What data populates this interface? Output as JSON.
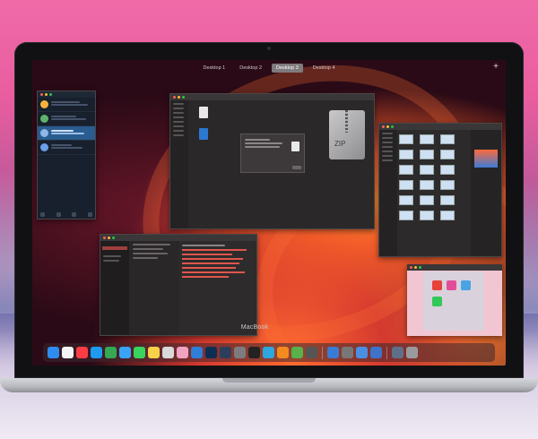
{
  "spaces": {
    "tabs": [
      {
        "label": "Desktop 1",
        "active": false
      },
      {
        "label": "Desktop 2",
        "active": false
      },
      {
        "label": "Desktop 3",
        "active": true
      },
      {
        "label": "Desktop 4",
        "active": false
      }
    ],
    "add_label": "+"
  },
  "finder": {
    "zip_label": "ZIP"
  },
  "laptop": {
    "brand": "MacBook"
  },
  "dock": {
    "icons": [
      {
        "name": "finder-icon",
        "color": "#2e8cf0"
      },
      {
        "name": "calendar-icon",
        "color": "#f4f4f4"
      },
      {
        "name": "music-icon",
        "color": "#fc3c44"
      },
      {
        "name": "app-store-icon",
        "color": "#1e9bf0"
      },
      {
        "name": "chrome-icon",
        "color": "#34a853"
      },
      {
        "name": "safari-icon",
        "color": "#3aa3f5"
      },
      {
        "name": "messages-icon",
        "color": "#3ad35c"
      },
      {
        "name": "notes-icon",
        "color": "#f7d14a"
      },
      {
        "name": "preview-icon",
        "color": "#d9d9d9"
      },
      {
        "name": "photos-icon",
        "color": "#f0a3c0"
      },
      {
        "name": "xcode-icon",
        "color": "#2f7ed8"
      },
      {
        "name": "photoshop-icon",
        "color": "#0c2e54"
      },
      {
        "name": "lightroom-icon",
        "color": "#2b3f5c"
      },
      {
        "name": "system-preferences-icon",
        "color": "#7c7c80"
      },
      {
        "name": "terminal-icon",
        "color": "#222"
      },
      {
        "name": "telegram-icon",
        "color": "#2ea6df"
      },
      {
        "name": "vlc-icon",
        "color": "#f28a1d"
      },
      {
        "name": "maps-icon",
        "color": "#5ab04a"
      },
      {
        "name": "settings-icon",
        "color": "#555"
      },
      {
        "name": "document-icon",
        "color": "#3a7bd5"
      },
      {
        "name": "image-capture-icon",
        "color": "#777"
      },
      {
        "name": "mail-icon",
        "color": "#4a90e2"
      },
      {
        "name": "downloads-icon",
        "color": "#3d73c8"
      },
      {
        "name": "stack-icon",
        "color": "#5f6f8a"
      },
      {
        "name": "trash-icon",
        "color": "#9a9a9e"
      }
    ]
  },
  "colors": {
    "accent_red": "#e0564c",
    "active_space": "#7f7a7e"
  }
}
